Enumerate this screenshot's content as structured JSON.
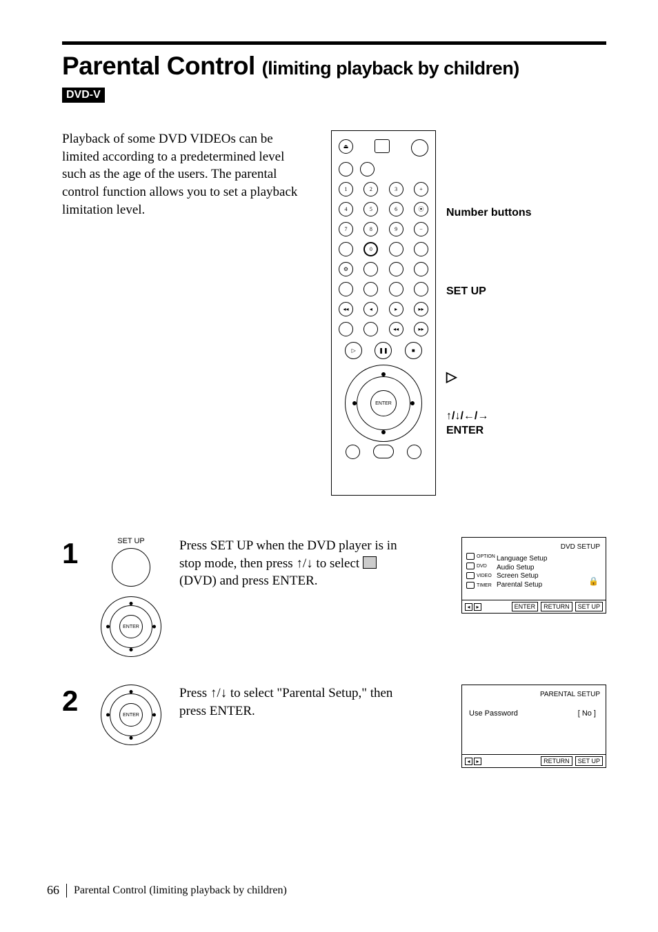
{
  "title_main": "Parental Control",
  "title_sub": "(limiting playback by children)",
  "badge": "DVD-V",
  "intro": "Playback of some DVD VIDEOs can be limited according to a predetermined level such as the age of the users.  The parental control function allows you to set a playback limitation level.",
  "remote_labels": {
    "number_buttons": "Number buttons",
    "set_up": "SET UP",
    "play": "▷",
    "arrows_enter_line1": "↑/↓/←/→",
    "arrows_enter_line2": "ENTER"
  },
  "dpad_center_label": "ENTER",
  "steps": [
    {
      "num": "1",
      "icon_label": "SET UP",
      "text_before": "Press SET UP when the DVD player is in stop mode, then press ↑/↓ to select ",
      "text_after": " (DVD) and press ENTER.",
      "show_setup_circle": true,
      "show_dpad": true,
      "osd": {
        "title": "DVD SETUP",
        "left_tabs": [
          "OPTION",
          "DVD",
          "VIDEO",
          "TIMER"
        ],
        "list": [
          "Language Setup",
          "Audio Setup",
          "Screen Setup",
          "Parental Setup"
        ],
        "show_lock": true,
        "foot_buttons": [
          "ENTER",
          "RETURN",
          "SET UP"
        ],
        "show_arrows_hint": true,
        "type": "dvd"
      }
    },
    {
      "num": "2",
      "icon_label": "",
      "text_before": "Press ↑/↓ to select \"Parental Setup,\" then press ENTER.",
      "text_after": "",
      "show_setup_circle": false,
      "show_dpad": true,
      "osd": {
        "title": "PARENTAL SETUP",
        "row_label": "Use Password",
        "row_value": "[ No ]",
        "foot_buttons": [
          "RETURN",
          "SET UP"
        ],
        "show_arrows_hint": true,
        "type": "parental"
      }
    }
  ],
  "footer": {
    "page_number": "66",
    "running_title": "Parental Control (limiting playback by children)"
  }
}
